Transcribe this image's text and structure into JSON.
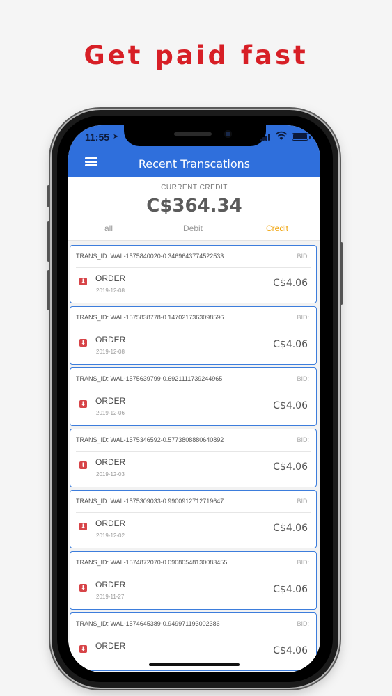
{
  "headline": "Get paid fast",
  "status_bar": {
    "time": "11:55"
  },
  "app_bar": {
    "title": "Recent Transcations",
    "menu_icon": "hamburger-menu-icon"
  },
  "summary": {
    "label": "CURRENT CREDIT",
    "amount": "C$364.34"
  },
  "filters": [
    {
      "label": "all",
      "active": false
    },
    {
      "label": "Debit",
      "active": false
    },
    {
      "label": "Credit",
      "active": true
    }
  ],
  "colors": {
    "headline": "#d71f26",
    "app_bar": "#2f6fdc",
    "active_filter": "#f0a30a",
    "card_border": "#3d7ddc",
    "order_icon": "#d74448"
  },
  "transactions": [
    {
      "trans_id": "TRANS_ID: WAL-1575840020-0.3469643774522533",
      "bid": "BID:",
      "type": "ORDER",
      "date": "2019-12-08",
      "amount": "C$4.06"
    },
    {
      "trans_id": "TRANS_ID: WAL-1575838778-0.1470217363098596",
      "bid": "BID:",
      "type": "ORDER",
      "date": "2019-12-08",
      "amount": "C$4.06"
    },
    {
      "trans_id": "TRANS_ID: WAL-1575639799-0.6921111739244965",
      "bid": "BID:",
      "type": "ORDER",
      "date": "2019-12-06",
      "amount": "C$4.06"
    },
    {
      "trans_id": "TRANS_ID: WAL-1575346592-0.5773808880640892",
      "bid": "BID:",
      "type": "ORDER",
      "date": "2019-12-03",
      "amount": "C$4.06"
    },
    {
      "trans_id": "TRANS_ID: WAL-1575309033-0.9900912712719647",
      "bid": "BID:",
      "type": "ORDER",
      "date": "2019-12-02",
      "amount": "C$4.06"
    },
    {
      "trans_id": "TRANS_ID: WAL-1574872070-0.09080548130083455",
      "bid": "BID:",
      "type": "ORDER",
      "date": "2019-11-27",
      "amount": "C$4.06"
    },
    {
      "trans_id": "TRANS_ID: WAL-1574645389-0.949971193002386",
      "bid": "BID:",
      "type": "ORDER",
      "date": "",
      "amount": "C$4.06"
    }
  ]
}
